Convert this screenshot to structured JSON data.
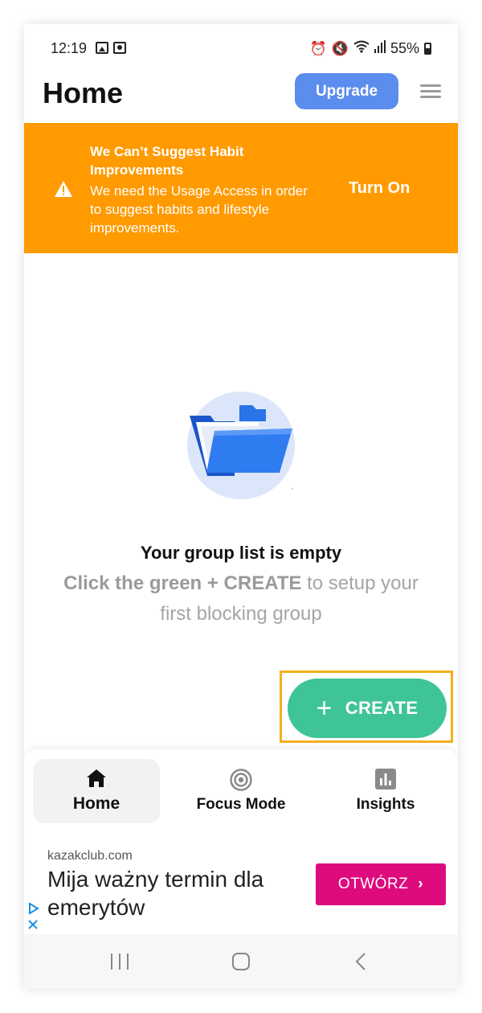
{
  "status_bar": {
    "time": "12:19",
    "battery": "55%"
  },
  "header": {
    "title": "Home",
    "upgrade_label": "Upgrade"
  },
  "banner": {
    "title": "We Can’t Suggest Habit Improvements",
    "body": "We need the Usage Access in order to suggest habits and lifestyle improvements.",
    "action": "Turn On",
    "color": "#ff9a00"
  },
  "empty_state": {
    "title": "Your group list is empty",
    "highlight": "Click the green + CREATE",
    "rest": " to setup your first blocking group"
  },
  "create_button": {
    "label": "CREATE",
    "color": "#3fc495"
  },
  "bottom_nav": {
    "items": [
      {
        "label": "Home",
        "icon": "home-icon",
        "active": true
      },
      {
        "label": "Focus Mode",
        "icon": "target-icon",
        "active": false
      },
      {
        "label": "Insights",
        "icon": "bar-chart-icon",
        "active": false
      }
    ]
  },
  "ad": {
    "domain": "kazakclub.com",
    "headline": "Mija ważny termin dla emerytów",
    "cta": "OTWÓRZ",
    "cta_color": "#de0b7e"
  },
  "colors": {
    "accent_blue": "#5b8def",
    "highlight_frame": "#f2b01e"
  }
}
